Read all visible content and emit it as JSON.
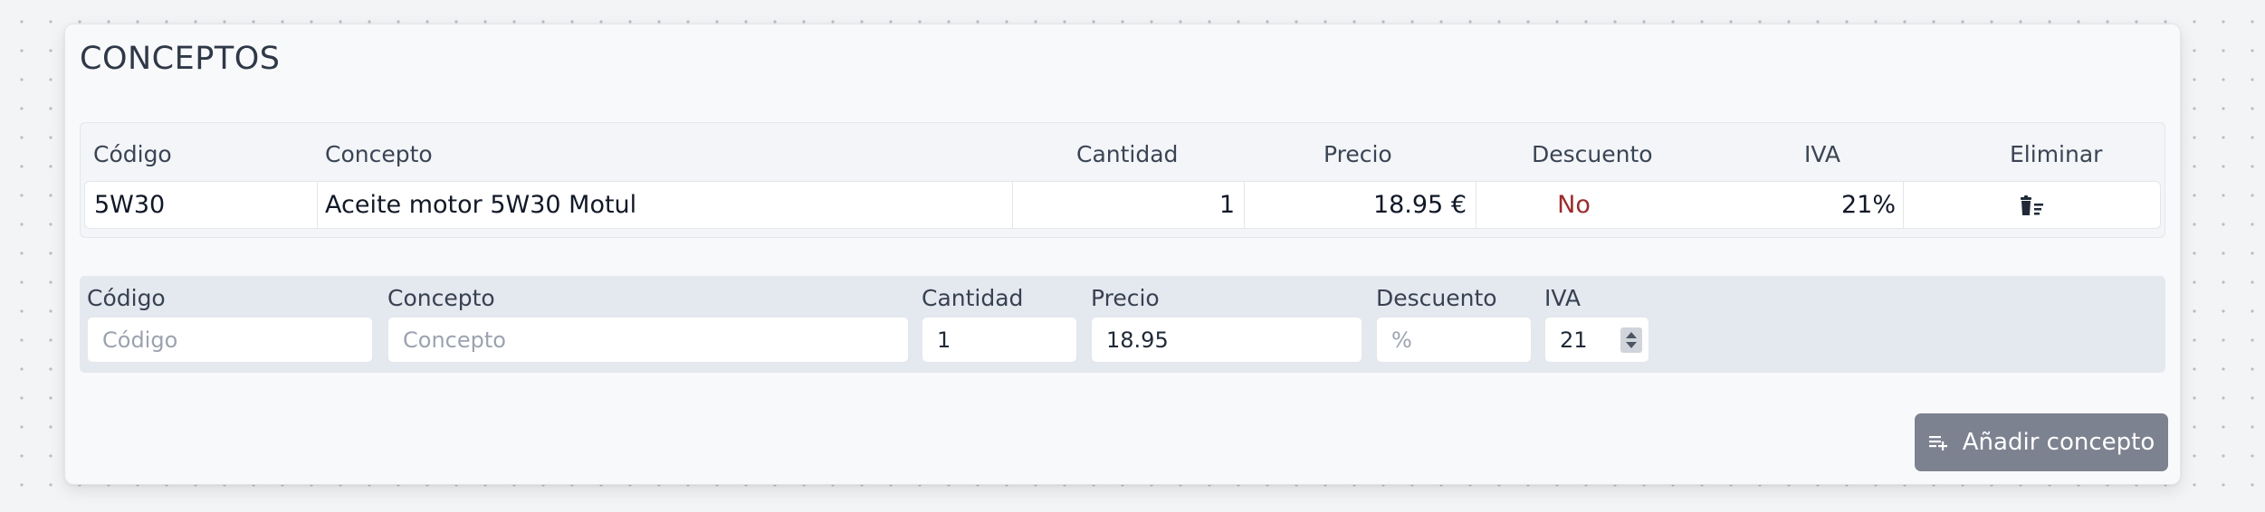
{
  "card": {
    "title": "CONCEPTOS"
  },
  "table": {
    "headers": [
      "Código",
      "Concepto",
      "Cantidad",
      "Precio",
      "Descuento",
      "IVA",
      "Eliminar"
    ],
    "rows": [
      {
        "codigo": "5W30",
        "concepto": "Aceite motor 5W30 Motul",
        "cantidad": "1",
        "precio": "18.95 €",
        "descuento": "No",
        "iva": "21%",
        "delete_icon": "trash-icon"
      }
    ]
  },
  "form": {
    "codigo": {
      "label": "Código",
      "placeholder": "Código",
      "value": ""
    },
    "concepto": {
      "label": "Concepto",
      "placeholder": "Concepto",
      "value": ""
    },
    "cantidad": {
      "label": "Cantidad",
      "placeholder": "",
      "value": "1"
    },
    "precio": {
      "label": "Precio",
      "placeholder": "",
      "value": "18.95"
    },
    "descuento": {
      "label": "Descuento",
      "placeholder": "%",
      "value": ""
    },
    "iva": {
      "label": "IVA",
      "placeholder": "",
      "value": "21"
    }
  },
  "add_button": {
    "label": "Añadir concepto",
    "icon": "add-list-icon"
  },
  "colors": {
    "button_bg": "#7d8290",
    "discount_no": "#9b2c2c",
    "form_bg": "#e4e8ef"
  }
}
